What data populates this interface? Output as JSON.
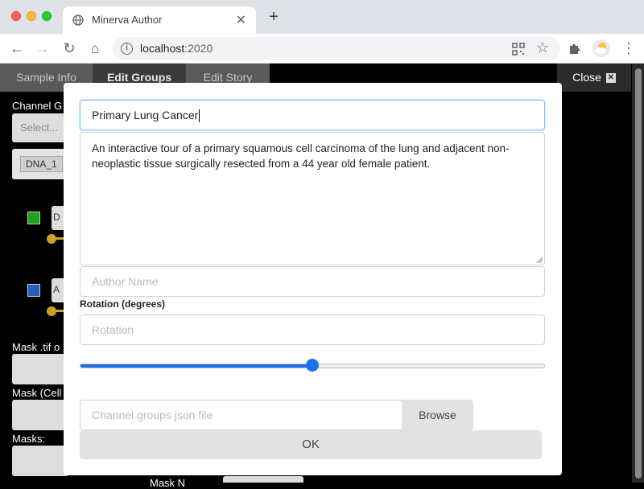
{
  "browser": {
    "tab_title": "Minerva Author",
    "tab_close": "✕",
    "new_tab": "+",
    "url_host": "localhost",
    "url_port": ":2020",
    "back": "←",
    "forward": "→",
    "reload": "↻",
    "home": "⌂",
    "star": "☆",
    "menu": "⋮"
  },
  "app": {
    "tabs": [
      {
        "label": "Sample Info"
      },
      {
        "label": "Edit Groups"
      },
      {
        "label": "Edit Story"
      }
    ],
    "close_label": "Close",
    "close_x": "✕",
    "background": {
      "channel_groups_label": "Channel G",
      "select_placeholder": "Select...",
      "dna_chip": "DNA_1",
      "mask_tif_label": "Mask .tif o",
      "mask_cell_label": "Mask (Cell",
      "masks_label": "Masks:",
      "ch1_letter": "D",
      "ch2_letter": "A",
      "bottom_label": "Mask N"
    },
    "accent_colors": {
      "green": "#1fa01f",
      "blue": "#1f5fbf",
      "gold": "#c9a227"
    }
  },
  "modal": {
    "title_value": "Primary Lung Cancer",
    "description_value": "An interactive tour of a primary squamous cell carcinoma of the lung and adjacent non-neoplastic tissue surgically resected from a 44 year old female patient.",
    "author_placeholder": "Author Name",
    "rotation_label": "Rotation (degrees)",
    "rotation_placeholder": "Rotation",
    "rotation_slider_fraction": 0.5,
    "json_placeholder": "Channel groups json file",
    "browse_label": "Browse",
    "ok_label": "OK"
  }
}
